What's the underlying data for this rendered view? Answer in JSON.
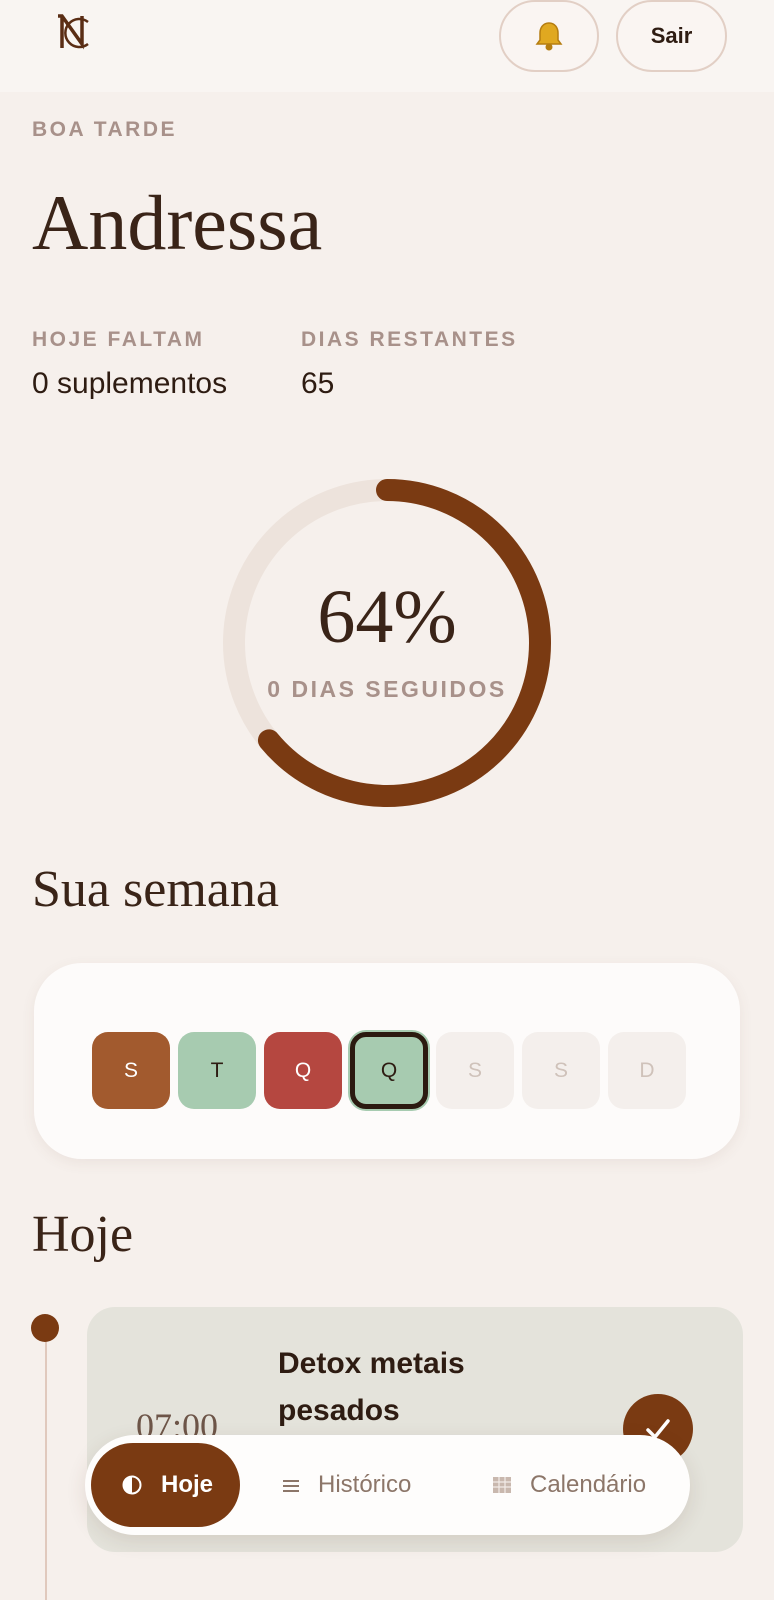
{
  "header": {
    "logo_text": "NC",
    "bell_icon": "bell-icon",
    "logout_label": "Sair"
  },
  "greeting": {
    "eyebrow": "BOA TARDE",
    "name": "Andressa"
  },
  "stats": {
    "today_label": "HOJE FALTAM",
    "today_value": "0 suplementos",
    "days_label": "DIAS RESTANTES",
    "days_value": "65"
  },
  "progress": {
    "percent_label": "64%",
    "percent": 64,
    "streak_label": "0 DIAS SEGUIDOS",
    "ring_color": "#7a3a12",
    "track_color": "#ede3dc"
  },
  "week": {
    "title": "Sua semana",
    "days": [
      {
        "label": "S",
        "status": "partial",
        "color": "#a25a2e"
      },
      {
        "label": "T",
        "status": "done",
        "color": "#a7cbb0"
      },
      {
        "label": "Q",
        "status": "missed",
        "color": "#b54740"
      },
      {
        "label": "Q",
        "status": "today",
        "color": "#a7cbb0"
      },
      {
        "label": "S",
        "status": "future",
        "color": "#f4efec"
      },
      {
        "label": "S",
        "status": "future",
        "color": "#f4efec"
      },
      {
        "label": "D",
        "status": "future",
        "color": "#f4efec"
      }
    ]
  },
  "today": {
    "title": "Hoje",
    "tasks": [
      {
        "time": "07:00",
        "title": "Detox metais pesados",
        "done_icon": "check-icon"
      }
    ]
  },
  "nav": {
    "items": [
      {
        "label": "Hoje",
        "icon": "half-moon-icon",
        "active": true
      },
      {
        "label": "Histórico",
        "icon": "list-icon",
        "active": false
      },
      {
        "label": "Calendário",
        "icon": "calendar-icon",
        "active": false
      }
    ]
  }
}
